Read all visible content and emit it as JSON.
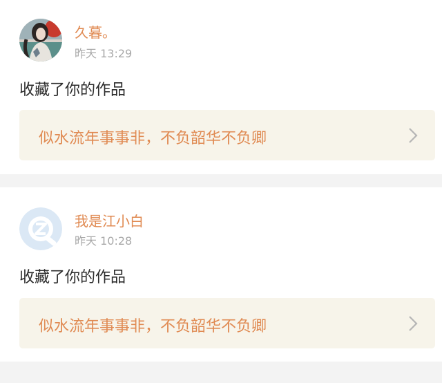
{
  "notifications": [
    {
      "username": "久暮。",
      "time": "昨天 13:29",
      "action": "收藏了你的作品",
      "work_title": "似水流年事事非，不负韶华不负卿",
      "avatar": "photo-avatar"
    },
    {
      "username": "我是江小白",
      "time": "昨天 10:28",
      "action": "收藏了你的作品",
      "work_title": "似水流年事事非，不负韶华不负卿",
      "avatar": "default-q-avatar"
    }
  ],
  "colors": {
    "username": "#e08a52",
    "work_title": "#e08a52",
    "time": "#a9a9a9",
    "card_bg": "#ffffff",
    "work_bg": "#f7f4ea",
    "page_bg": "#f3f3f3",
    "default_avatar": "#dbe8f5"
  }
}
